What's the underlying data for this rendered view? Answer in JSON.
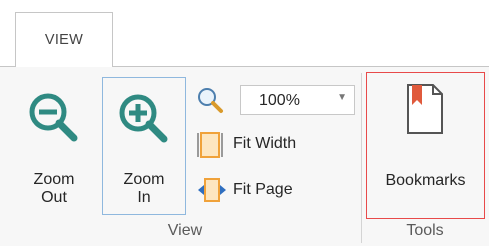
{
  "tabs": [
    {
      "label": "VIEW",
      "active": true
    }
  ],
  "ribbon": {
    "view_group": {
      "label": "View",
      "zoom_out": {
        "line1": "Zoom",
        "line2": "Out",
        "icon": "zoom-out-icon"
      },
      "zoom_in": {
        "line1": "Zoom",
        "line2": "In",
        "icon": "zoom-in-icon",
        "selected": true
      },
      "zoom_combo": {
        "value": "100%",
        "icon": "magnifier-icon"
      },
      "fit_width": {
        "label": "Fit Width",
        "icon": "fit-width-icon"
      },
      "fit_page": {
        "label": "Fit Page",
        "icon": "fit-page-icon"
      }
    },
    "tools_group": {
      "label": "Tools",
      "bookmarks": {
        "label": "Bookmarks",
        "icon": "bookmark-icon",
        "highlighted": true
      }
    }
  },
  "colors": {
    "icon_teal": "#2f8a82",
    "bookmark_red": "#e05a3c",
    "selected_border": "#8fb8de",
    "highlight_border": "#e84a4a",
    "fit_orange": "#f0a23a",
    "fit_blue": "#2f6fc0"
  }
}
